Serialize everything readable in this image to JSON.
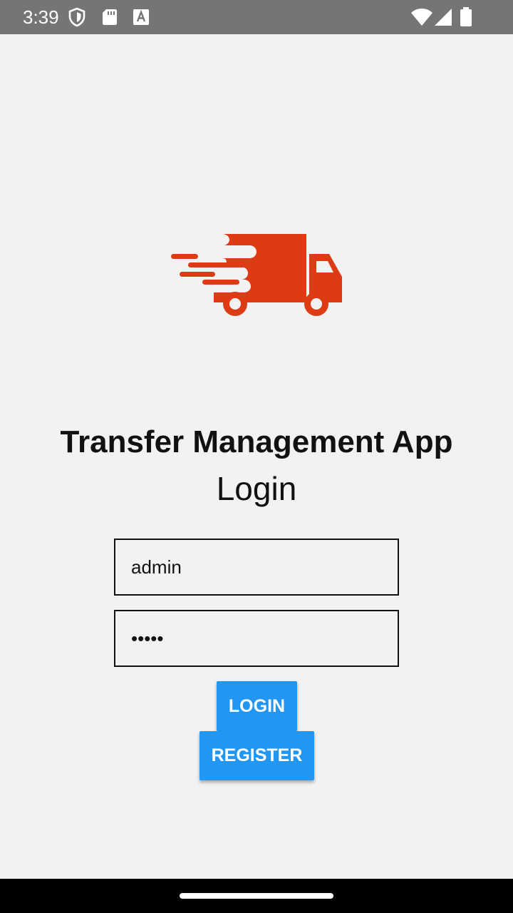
{
  "status_bar": {
    "time": "3:39",
    "icons": [
      "shield-icon",
      "sd-card-icon",
      "font-a-icon",
      "wifi-icon",
      "signal-icon",
      "battery-icon"
    ]
  },
  "app": {
    "logo_icon": "fast-delivery-truck-icon",
    "logo_color": "#dd3b15",
    "title": "Transfer Management App",
    "subtitle": "Login"
  },
  "form": {
    "username_value": "admin",
    "password_value": "admin",
    "login_label": "LOGIN",
    "register_label": "REGISTER",
    "button_color": "#2196f3"
  }
}
